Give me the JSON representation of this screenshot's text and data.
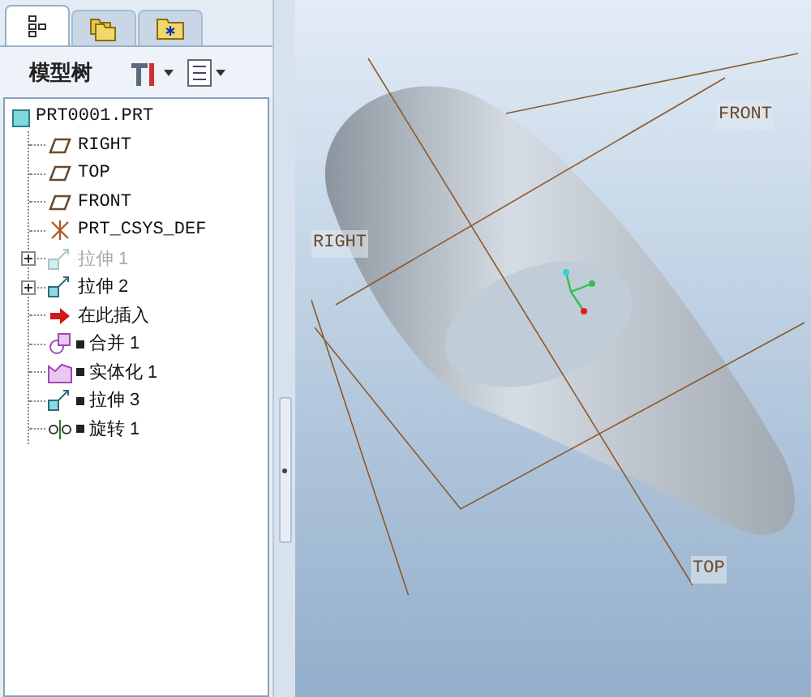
{
  "tabs": [
    {
      "kind": "tree",
      "selected": true
    },
    {
      "kind": "folders",
      "selected": false
    },
    {
      "kind": "favorites",
      "selected": false
    }
  ],
  "panel": {
    "title": "模型树"
  },
  "tree": {
    "label": "PRT0001.PRT",
    "kind": "part",
    "children": [
      {
        "label": "RIGHT",
        "kind": "plane",
        "expandable": false,
        "suppressed": false,
        "marker": false
      },
      {
        "label": "TOP",
        "kind": "plane",
        "expandable": false,
        "suppressed": false,
        "marker": false
      },
      {
        "label": "FRONT",
        "kind": "plane",
        "expandable": false,
        "suppressed": false,
        "marker": false
      },
      {
        "label": "PRT_CSYS_DEF",
        "kind": "csys",
        "expandable": false,
        "suppressed": false,
        "marker": false
      },
      {
        "label": "拉伸 1",
        "kind": "extrude",
        "expandable": true,
        "suppressed": true,
        "marker": false
      },
      {
        "label": "拉伸 2",
        "kind": "extrude",
        "expandable": true,
        "suppressed": false,
        "marker": false
      },
      {
        "label": "在此插入",
        "kind": "insert",
        "expandable": false,
        "suppressed": false,
        "marker": false
      },
      {
        "label": "合并 1",
        "kind": "merge",
        "expandable": false,
        "suppressed": false,
        "marker": true
      },
      {
        "label": "实体化 1",
        "kind": "solidify",
        "expandable": false,
        "suppressed": false,
        "marker": true
      },
      {
        "label": "拉伸 3",
        "kind": "extrude",
        "expandable": false,
        "suppressed": false,
        "marker": true
      },
      {
        "label": "旋转 1",
        "kind": "revolve",
        "expandable": false,
        "suppressed": false,
        "marker": true
      }
    ]
  },
  "viewport": {
    "plane_labels": [
      {
        "label": "RIGHT",
        "kind": "right"
      },
      {
        "label": "FRONT",
        "kind": "front"
      },
      {
        "label": "TOP",
        "kind": "top"
      }
    ]
  }
}
